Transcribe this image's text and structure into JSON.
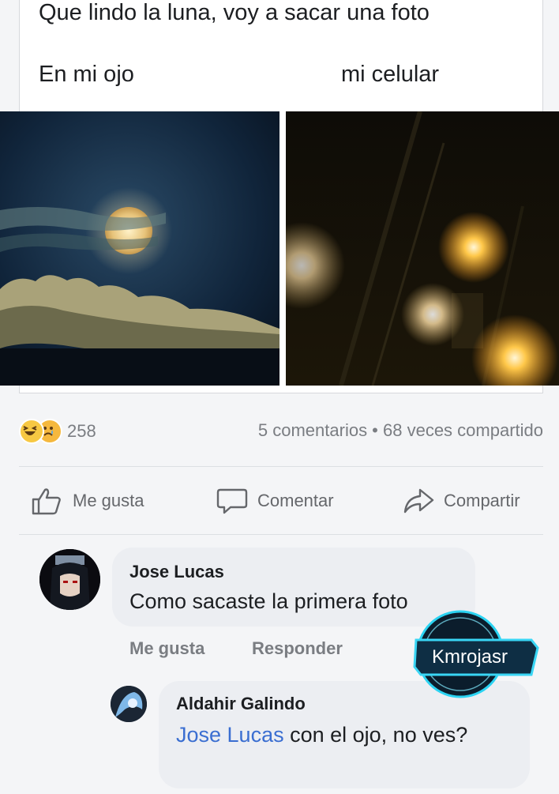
{
  "post": {
    "caption": "Que lindo la luna, voy a sacar una foto",
    "label_left": "En mi ojo",
    "label_right": "mi celular"
  },
  "stats": {
    "reaction_count": "258",
    "summary": "5 comentarios • 68 veces compartido"
  },
  "actions": {
    "like": "Me gusta",
    "comment": "Comentar",
    "share": "Compartir"
  },
  "comments": [
    {
      "author": "Jose Lucas",
      "text": "Como sacaste la primera foto",
      "like": "Me gusta",
      "reply": "Responder"
    },
    {
      "author": "Aldahir Galindo",
      "mention": "Jose Lucas",
      "text": " con el ojo, no ves?"
    }
  ],
  "watermark": "Kmrojasr",
  "icons": [
    "thumbs-up-icon",
    "speech-bubble-icon",
    "share-arrow-icon",
    "haha-emoji-icon",
    "sad-emoji-icon"
  ],
  "colors": {
    "mention": "#3a6ed1",
    "muted": "#7a7d82",
    "bubble": "#eceef2"
  }
}
